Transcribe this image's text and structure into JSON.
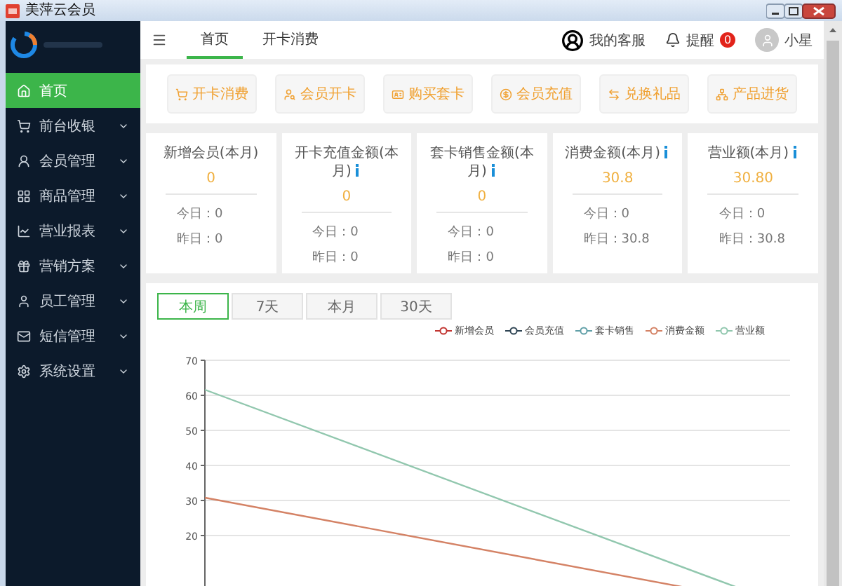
{
  "window": {
    "title": "美萍云会员"
  },
  "sidebar": {
    "items": [
      {
        "label": "首页",
        "kind": "link",
        "selected": true
      },
      {
        "label": "前台收银",
        "kind": "menu",
        "selected": false
      },
      {
        "label": "会员管理",
        "kind": "menu",
        "selected": false
      },
      {
        "label": "商品管理",
        "kind": "menu",
        "selected": false
      },
      {
        "label": "营业报表",
        "kind": "menu",
        "selected": false
      },
      {
        "label": "营销方案",
        "kind": "menu",
        "selected": false
      },
      {
        "label": "员工管理",
        "kind": "menu",
        "selected": false
      },
      {
        "label": "短信管理",
        "kind": "menu",
        "selected": false
      },
      {
        "label": "系统设置",
        "kind": "menu",
        "selected": false
      }
    ]
  },
  "header": {
    "tabs": [
      {
        "label": "首页",
        "selected": true
      },
      {
        "label": "开卡消费",
        "selected": false
      }
    ],
    "support": "我的客服",
    "reminder": "提醒",
    "reminder_count": "0",
    "user": "小星"
  },
  "quick_actions": [
    "开卡消费",
    "会员开卡",
    "购买套卡",
    "会员充值",
    "兑换礼品",
    "产品进货"
  ],
  "stats": [
    {
      "title": "新增会员(本月)",
      "info": false,
      "value": "0",
      "today": "今日：0",
      "yesterday": "昨日：0"
    },
    {
      "title": "开卡充值金额(本月)",
      "info": true,
      "value": "0",
      "today": "今日：0",
      "yesterday": "昨日：0"
    },
    {
      "title": "套卡销售金额(本月)",
      "info": true,
      "value": "0",
      "today": "今日：0",
      "yesterday": "昨日：0"
    },
    {
      "title": "消费金额(本月)",
      "info": true,
      "value": "30.8",
      "today": "今日：0",
      "yesterday": "昨日：30.8"
    },
    {
      "title": "营业额(本月)",
      "info": true,
      "value": "30.80",
      "today": "今日：0",
      "yesterday": "昨日：30.8"
    }
  ],
  "chart_panel": {
    "ranges": [
      {
        "label": "本周",
        "selected": true
      },
      {
        "label": "7天",
        "selected": false
      },
      {
        "label": "本月",
        "selected": false
      },
      {
        "label": "30天",
        "selected": false
      }
    ],
    "legend": [
      {
        "name": "新增会员",
        "color": "#c23531"
      },
      {
        "name": "会员充值",
        "color": "#2f4554"
      },
      {
        "name": "套卡销售",
        "color": "#61a0a8"
      },
      {
        "name": "消费金额",
        "color": "#d48265"
      },
      {
        "name": "营业额",
        "color": "#91c7ae"
      }
    ],
    "y_axis_labels": [
      "70",
      "60",
      "50",
      "40",
      "30",
      "20"
    ]
  }
}
